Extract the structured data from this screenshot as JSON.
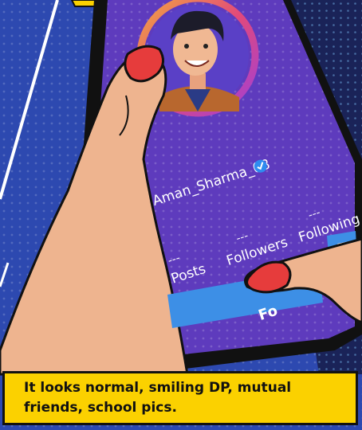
{
  "profile": {
    "username": "Aman_Sharma_08",
    "verified": true,
    "stats": [
      {
        "value": "---",
        "label": "Posts"
      },
      {
        "value": "---",
        "label": "Followers"
      },
      {
        "value": "---",
        "label": "Following"
      }
    ],
    "follow_label": "Fo",
    "dropdown_icon": "triangle-down-icon"
  },
  "caption": {
    "text": "It looks normal, smiling DP, mutual\nfriends, school pics."
  },
  "colors": {
    "phone_screen": "#5e3bbd",
    "follow_button": "#3d8fe6",
    "caption_bg": "#fbd100",
    "nail": "#e63c3c",
    "skin": "#eeb48f"
  }
}
